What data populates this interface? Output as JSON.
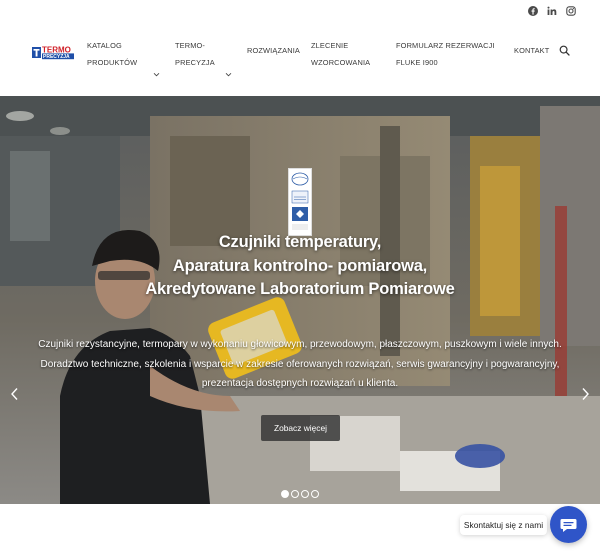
{
  "social": {
    "icons": [
      "facebook-icon",
      "linkedin-icon",
      "instagram-icon"
    ]
  },
  "header": {
    "logo_icon": "termo-precyzja-logo",
    "nav": [
      {
        "line1": "KATALOG",
        "line2": "PRODUKTÓW",
        "has_dropdown": true
      },
      {
        "line1": "TERMO-",
        "line2": "PRECYZJA",
        "has_dropdown": true
      },
      {
        "line1": "ROZWIĄZANIA",
        "line2": "",
        "has_dropdown": false
      },
      {
        "line1": "ZLECENIE",
        "line2": "WZORCOWANIA",
        "has_dropdown": false
      },
      {
        "line1": "FORMULARZ REZERWACJI",
        "line2": "FLUKE I900",
        "has_dropdown": false
      },
      {
        "line1": "KONTAKT",
        "line2": "",
        "has_dropdown": false
      }
    ],
    "search_icon": "search-icon"
  },
  "hero": {
    "title_lines": [
      "Czujniki temperatury,",
      "Aparatura kontrolno- pomiarowa,",
      "Akredytowane Laboratorium Pomiarowe"
    ],
    "description_lines": [
      "Czujniki rezystancyjne, termopary w wykonaniu głowicowym, przewodowym, płaszczowym, puszkowym i wiele innych.",
      "Doradztwo techniczne, szkolenia i wsparcie w zakresie oferowanych rozwiązań, serwis gwarancyjny i pogwarancyjny,",
      "prezentacja dostępnych rozwiązań u klienta."
    ],
    "button_label": "Zobacz więcej",
    "slides_total": 4,
    "active_slide": 1,
    "accent_colors": {
      "machine": "#8a7f6a",
      "floor": "#6e6e6e"
    }
  },
  "chat": {
    "label": "Skontaktuj się z nami",
    "icon": "chat-bubble-icon",
    "color": "#2f55c8"
  }
}
